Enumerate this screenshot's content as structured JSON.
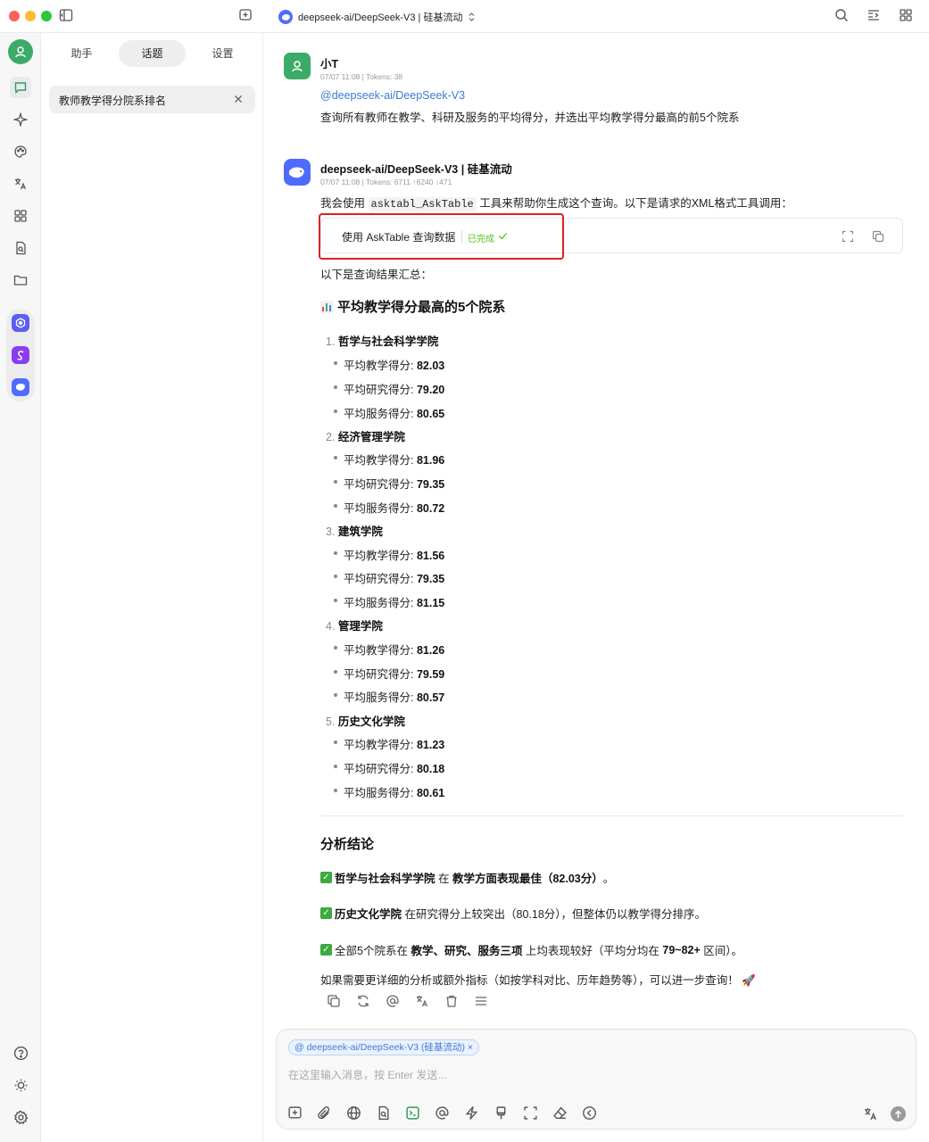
{
  "titlebar": {
    "model_title": "deepseek-ai/DeepSeek-V3 | 硅基流动",
    "icons": [
      "sidebar-toggle-icon",
      "new-topic-icon",
      "chevron-updown-icon",
      "search-icon",
      "display-mode-icon",
      "grid-layout-icon"
    ]
  },
  "rail": {
    "icons": [
      "user-avatar",
      "chat-icon",
      "sparkle-icon",
      "palette-icon",
      "translate-icon",
      "apps-icon",
      "knowledge-icon",
      "folder-icon",
      "help-icon",
      "theme-icon",
      "settings-icon"
    ],
    "apps": [
      "minapp-1",
      "minapp-2",
      "deepseek-app"
    ]
  },
  "panel": {
    "tabs": [
      "助手",
      "话题",
      "设置"
    ],
    "active_tab": "话题",
    "topic": "教师教学得分院系排名"
  },
  "user_msg": {
    "name": "小T",
    "meta": "07/07 11:08  |  Tokens: 38",
    "mention": "@deepseek-ai/DeepSeek-V3",
    "text": "查询所有教师在教学、科研及服务的平均得分，并选出平均教学得分最高的前5个院系"
  },
  "ai_msg": {
    "name": "deepseek-ai/DeepSeek-V3 | 硅基流动",
    "meta": "07/07 11:08  |  Tokens: 6711  ↑6240  ↓471",
    "intro_before": "我会使用",
    "intro_code": "asktabl_AskTable",
    "intro_after": "工具来帮助你生成这个查询。以下是请求的XML格式工具调用：",
    "tool_label": "使用 AskTable 查询数据",
    "tool_status": "已完成",
    "summary": "以下是查询结果汇总：",
    "heading": "平均教学得分最高的5个院系",
    "label_teach": "平均教学得分: ",
    "label_research": "平均研究得分: ",
    "label_service": "平均服务得分: ",
    "depts": [
      {
        "num": "1.",
        "name": "哲学与社会科学学院",
        "teach": "82.03",
        "research": "79.20",
        "service": "80.65"
      },
      {
        "num": "2.",
        "name": "经济管理学院",
        "teach": "81.96",
        "research": "79.35",
        "service": "80.72"
      },
      {
        "num": "3.",
        "name": "建筑学院",
        "teach": "81.56",
        "research": "79.35",
        "service": "81.15"
      },
      {
        "num": "4.",
        "name": "管理学院",
        "teach": "81.26",
        "research": "79.59",
        "service": "80.57"
      },
      {
        "num": "5.",
        "name": "历史文化学院",
        "teach": "81.23",
        "research": "80.18",
        "service": "80.61"
      }
    ],
    "analysis_title": "分析结论",
    "c1_b1": "哲学与社会科学学院",
    "c1_t1": " 在 ",
    "c1_b2": "教学方面表现最佳（82.03分）",
    "c1_t2": "。",
    "c2_b1": "历史文化学院",
    "c2_t1": " 在研究得分上较突出（80.18分），但整体仍以教学得分排序。",
    "c3_t1": "全部5个院系在 ",
    "c3_b1": "教学、研究、服务三项",
    "c3_t2": " 上均表现较好（平均分均在 ",
    "c3_b2": "79~82+",
    "c3_t3": " 区间）。",
    "closing": "如果需要更详细的分析或额外指标（如按学科对比、历年趋势等），可以进一步查询！ 🚀"
  },
  "input": {
    "chip": "@ deepseek-ai/DeepSeek-V3 (硅基流动)  ×",
    "placeholder": "在这里输入消息，按 Enter 发送..."
  },
  "colors": {
    "accent": "#3c7ad6",
    "success": "#52c41a",
    "highlight": "#e02020",
    "user_avatar": "#3daa67",
    "deepseek": "#4d6bfe"
  }
}
